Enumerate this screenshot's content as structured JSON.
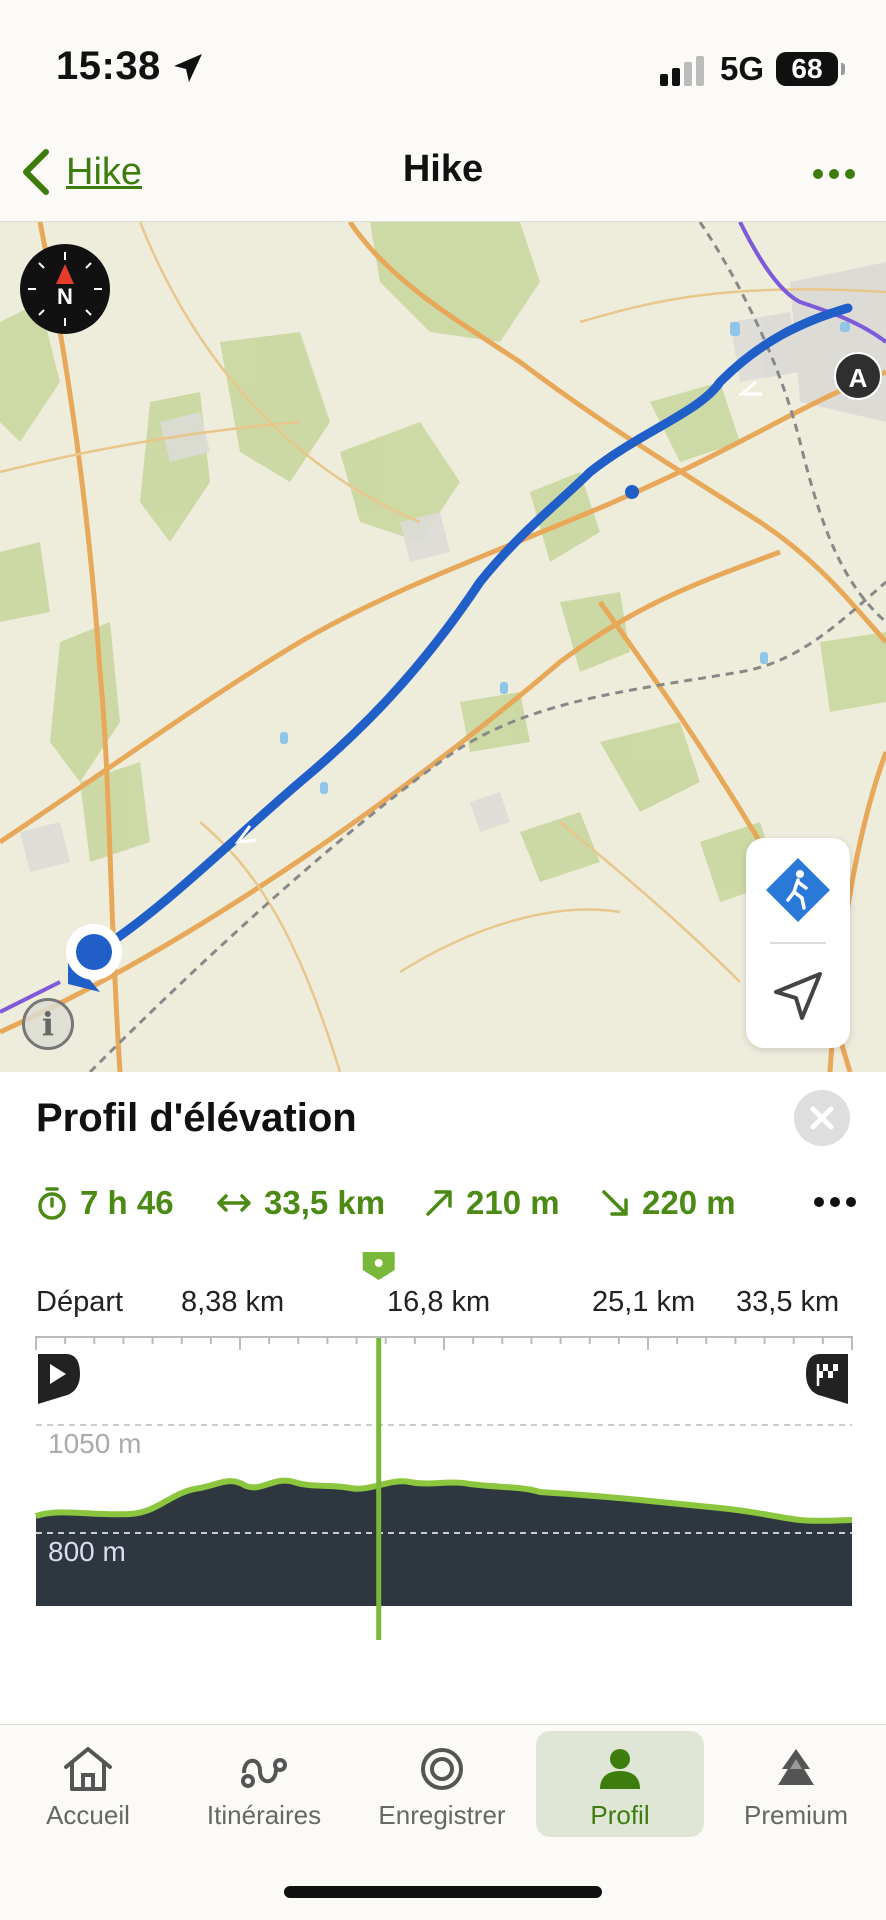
{
  "status_bar": {
    "time": "15:38",
    "network": "5G",
    "battery": "68"
  },
  "nav": {
    "back_label": "Hike",
    "title": "Hike"
  },
  "map": {
    "start_marker_label": "A",
    "compass_label": "N",
    "route_color": "#1f5fc7",
    "accent_color": "#4b8a14"
  },
  "elevation_panel": {
    "title": "Profil d'élévation",
    "stats": {
      "duration": "7 h 46",
      "distance": "33,5 km",
      "ascent": "210 m",
      "descent": "220 m"
    },
    "distance_ticks": [
      "Départ",
      "8,38 km",
      "16,8 km",
      "25,1 km",
      "33,5 km"
    ],
    "elevation_labels": [
      "1050 m",
      "800 m"
    ],
    "cursor_fraction": 0.42
  },
  "tabbar": {
    "items": [
      {
        "label": "Accueil",
        "icon": "home-icon"
      },
      {
        "label": "Itinéraires",
        "icon": "route-icon"
      },
      {
        "label": "Enregistrer",
        "icon": "record-icon"
      },
      {
        "label": "Profil",
        "icon": "profile-icon",
        "active": true
      },
      {
        "label": "Premium",
        "icon": "premium-icon"
      }
    ]
  }
}
